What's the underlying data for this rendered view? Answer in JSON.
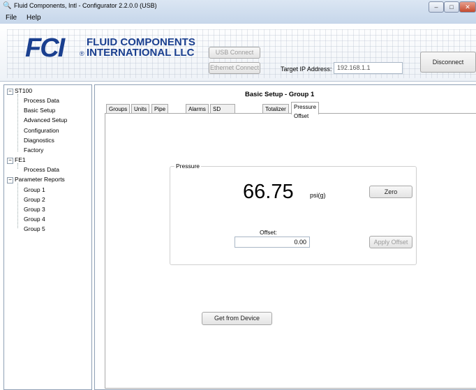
{
  "window": {
    "title": "Fluid Components, Intl - Configurator 2.2.0.0 (USB)",
    "icon": "binoculars-icon",
    "controls": {
      "minimize": "–",
      "maximize": "□",
      "close": "✕"
    }
  },
  "menu": {
    "file": "File",
    "help": "Help"
  },
  "banner": {
    "logo_mark": "FCI",
    "logo_registered": "®",
    "company_line1": "FLUID COMPONENTS",
    "company_line2": "INTERNATIONAL LLC",
    "usb_connect": "USB Connect",
    "ethernet_connect": "Ethernet Connect",
    "target_ip_label": "Target IP Address:",
    "target_ip_value": "192.168.1.1",
    "disconnect": "Disconnect"
  },
  "tree": {
    "st100": "ST100",
    "st100_items": [
      "Process Data",
      "Basic Setup",
      "Advanced Setup",
      "Configuration",
      "Diagnostics",
      "Factory"
    ],
    "fe1": "FE1",
    "fe1_items": [
      "Process Data"
    ],
    "reports": "Parameter Reports",
    "report_items": [
      "Group 1",
      "Group 2",
      "Group 3",
      "Group 4",
      "Group 5"
    ]
  },
  "main": {
    "heading": "Basic Setup - Group 1",
    "tabs": [
      "Groups",
      "Units",
      "Pipe Size",
      "Alarms",
      "SD Card Logging",
      "Totalizer",
      "Pressure Offset"
    ],
    "active_tab": "Pressure Offset",
    "pressure_group_label": "Pressure",
    "pressure_value": "66.75",
    "pressure_unit": "psi(g)",
    "zero_button": "Zero",
    "offset_label": "Offset:",
    "offset_value": "0.00",
    "apply_offset": "Apply Offset",
    "get_from_device": "Get from Device"
  }
}
